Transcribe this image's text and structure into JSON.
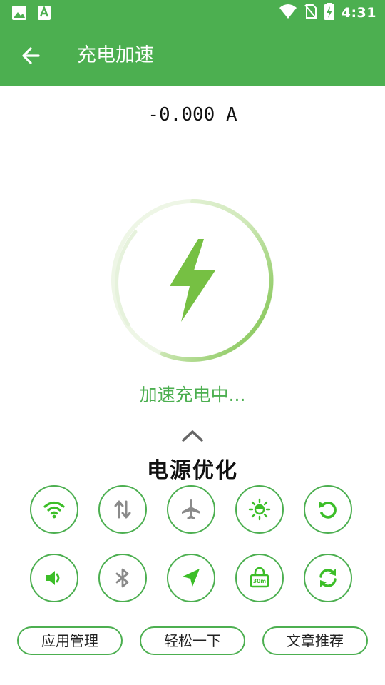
{
  "status_bar": {
    "time": "4:31",
    "left_icons": [
      "image-icon",
      "text-a-icon"
    ],
    "right_icons": [
      "wifi-icon",
      "no-sim-icon",
      "battery-charging-icon"
    ]
  },
  "app_bar": {
    "title": "充电加速",
    "back_icon": "arrow-left-icon",
    "color": "#4caf50"
  },
  "current_reading": "-0.000 A",
  "charge_ring": {
    "icon": "lightning-bolt-icon",
    "accent": "#76c043"
  },
  "charging_status": "加速充电中...",
  "section": {
    "expand_icon": "chevron-up-icon",
    "title": "电源优化"
  },
  "toggles": [
    {
      "icon": "wifi-icon",
      "active": true
    },
    {
      "icon": "data-sync-icon",
      "active": false
    },
    {
      "icon": "airplane-icon",
      "active": false
    },
    {
      "icon": "brightness-icon",
      "active": true
    },
    {
      "icon": "auto-rotate-icon",
      "active": true
    },
    {
      "icon": "volume-icon",
      "active": true
    },
    {
      "icon": "bluetooth-icon",
      "active": false
    },
    {
      "icon": "location-icon",
      "active": true
    },
    {
      "icon": "screen-lock-timeout-icon",
      "active": true,
      "label": "30m"
    },
    {
      "icon": "sync-icon",
      "active": true
    }
  ],
  "buttons": {
    "app_manage": "应用管理",
    "relax": "轻松一下",
    "articles": "文章推荐"
  },
  "colors": {
    "primary": "#4caf50",
    "active_icon": "#3cbe28",
    "inactive_icon": "#8a8a8a"
  }
}
